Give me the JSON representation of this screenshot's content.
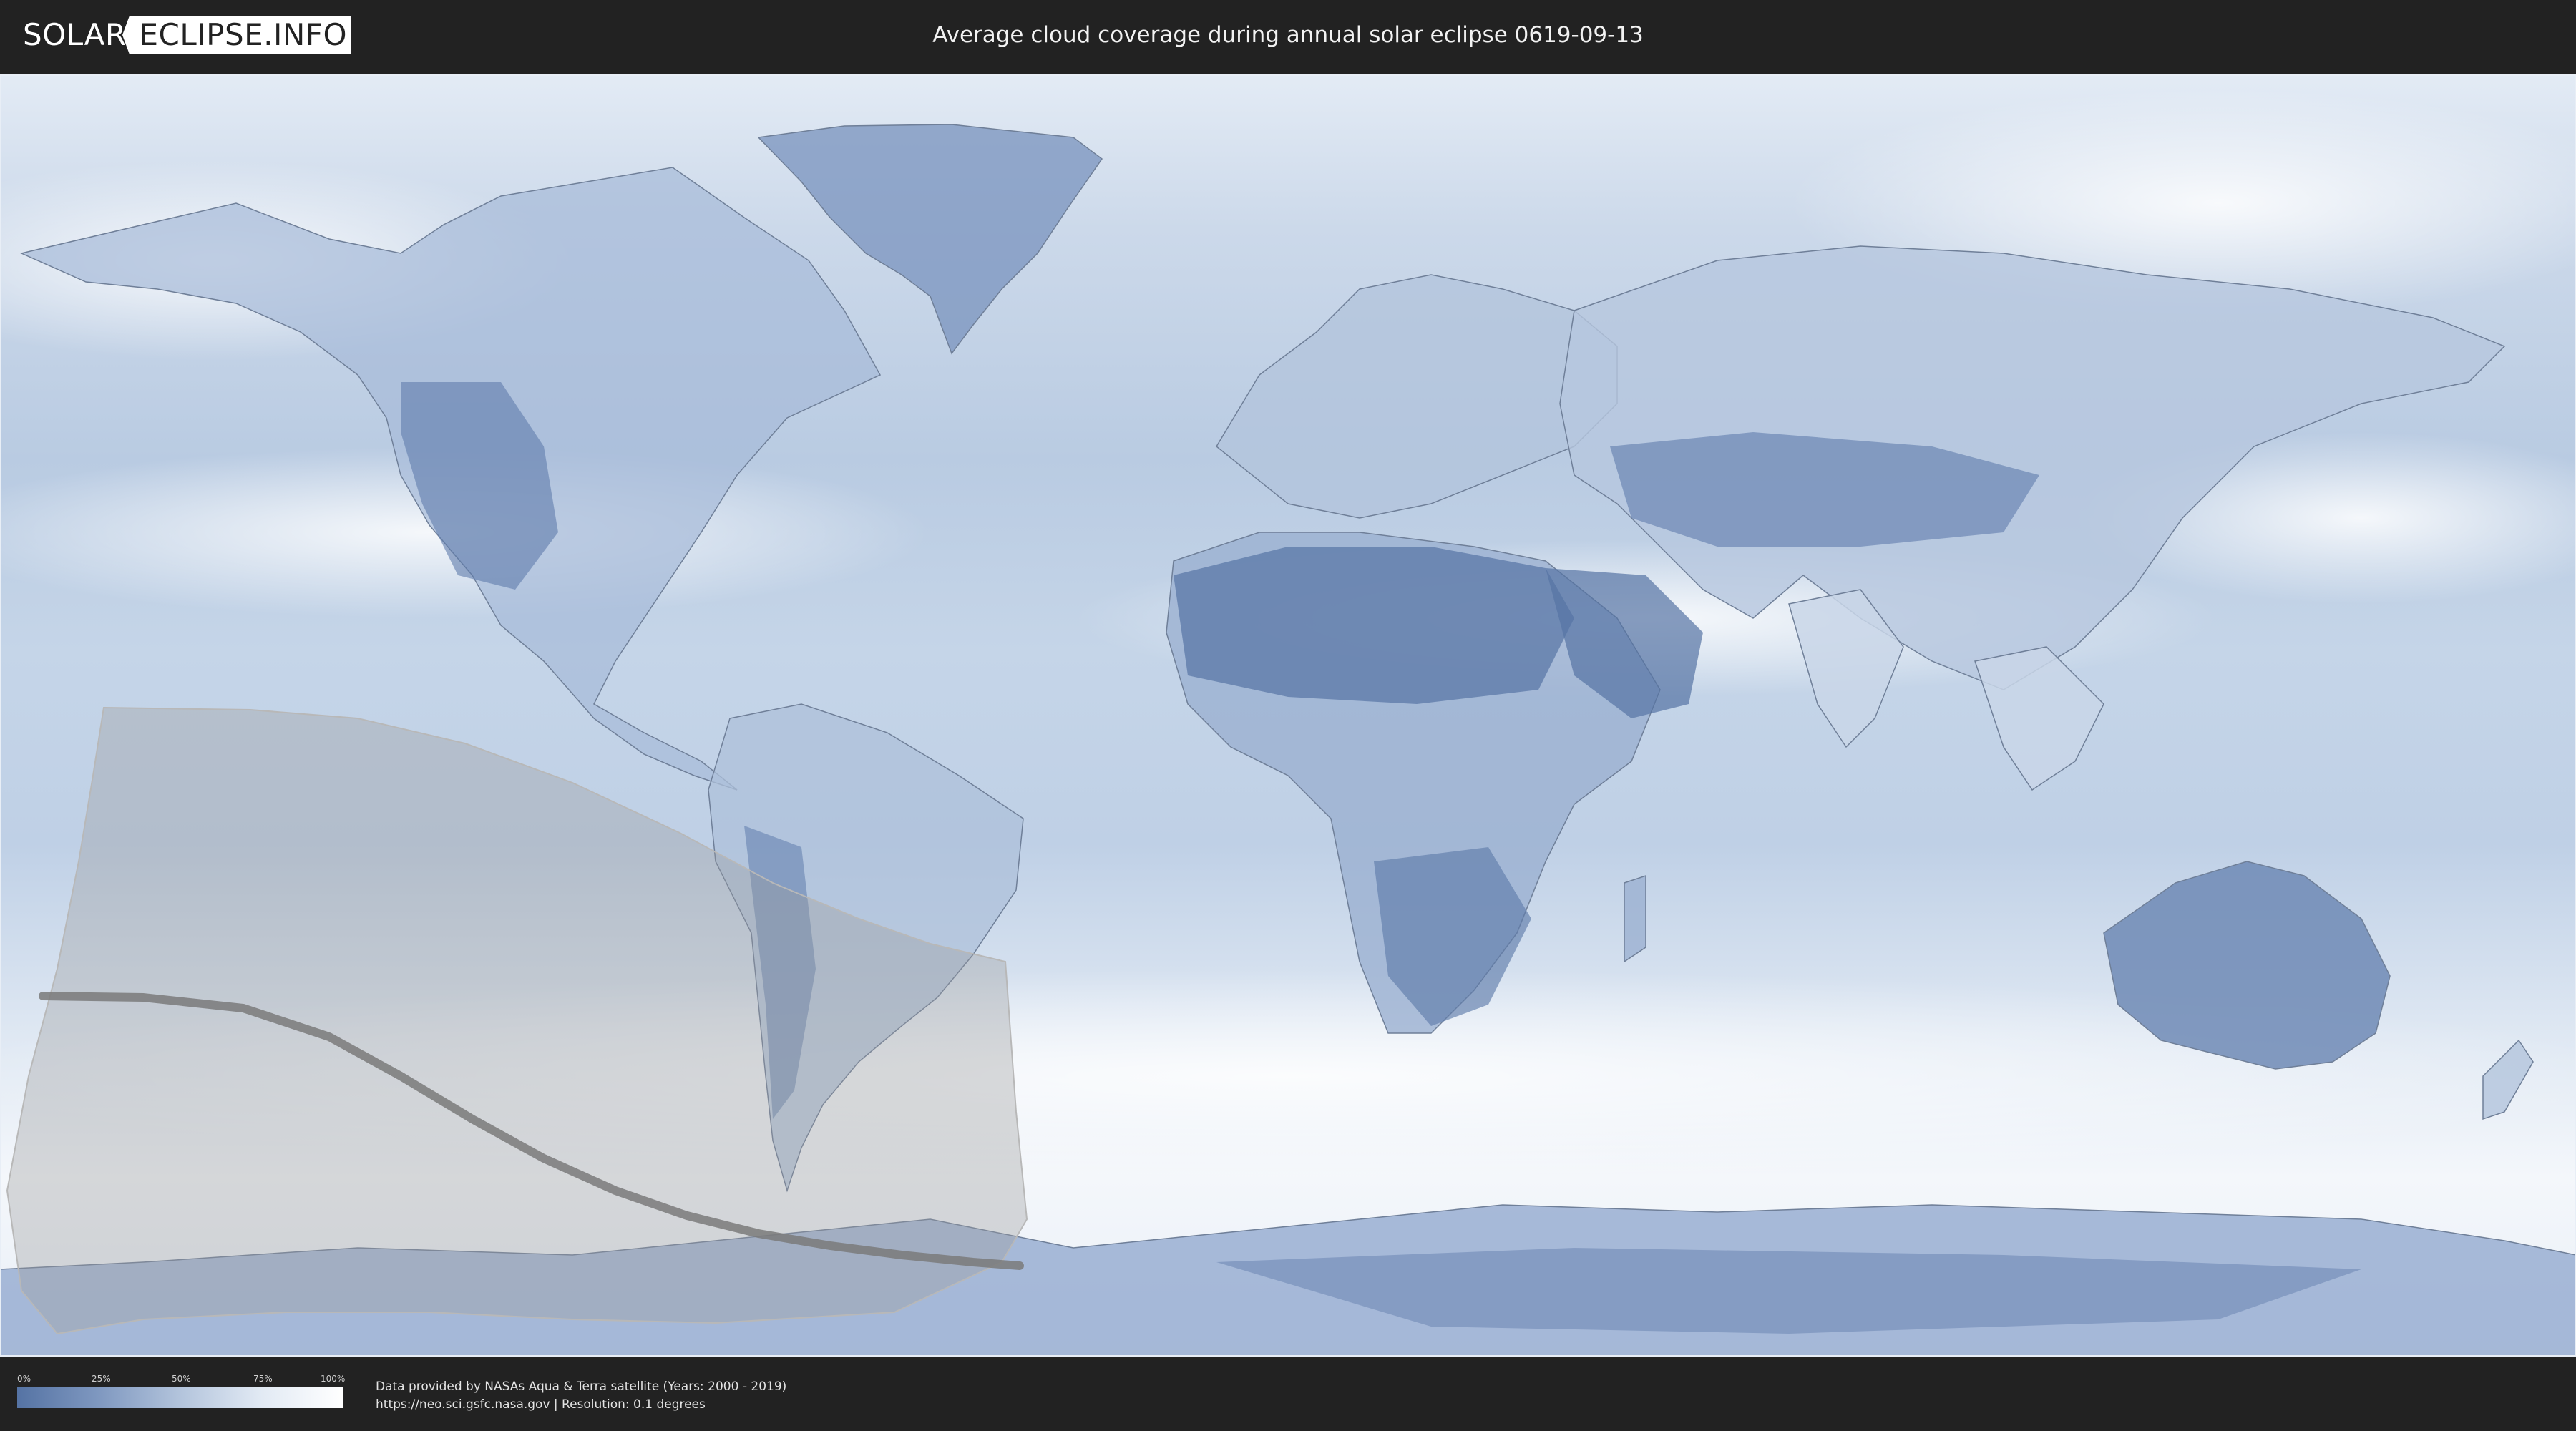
{
  "header": {
    "logo_left": "SOLAR",
    "logo_right": "ECLIPSE.INFO",
    "title": "Average cloud coverage during annual solar eclipse 0619-09-13"
  },
  "map": {
    "type": "cloud-coverage-world-map",
    "projection": "equirectangular",
    "overlay": "eclipse visibility zone with central annular path",
    "colors": {
      "clear": "#5573a4",
      "cloudy": "#ffffff",
      "overlay": "#9a9a9a",
      "central_path": "#7a7a7a",
      "coastline": "#6f7f98"
    }
  },
  "legend": {
    "ticks": [
      "0%",
      "25%",
      "50%",
      "75%",
      "100%"
    ],
    "tick_values": [
      0,
      25,
      50,
      75,
      100
    ]
  },
  "credits": {
    "line1": "Data provided by NASAs Aqua & Terra satellite (Years: 2000 - 2019)",
    "line2": "https://neo.sci.gsfc.nasa.gov | Resolution: 0.1 degrees"
  }
}
